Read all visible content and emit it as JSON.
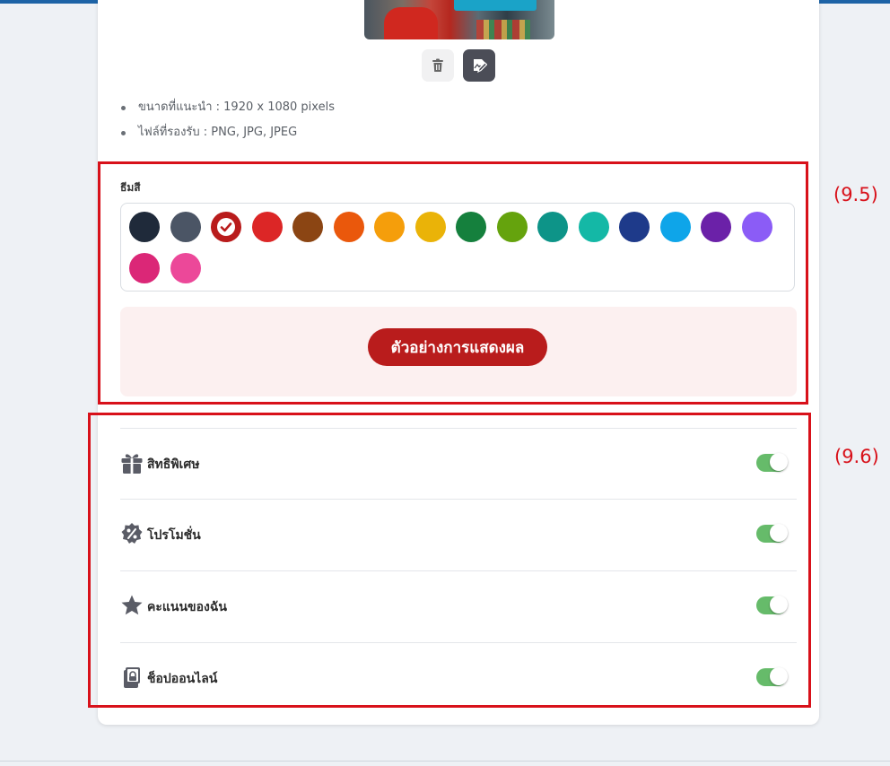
{
  "upload": {
    "hints": [
      "ขนาดที่แนะนำ : 1920 x 1080 pixels",
      "ไฟล์ที่รองรับ : PNG, JPG, JPEG"
    ]
  },
  "theme": {
    "label": "ธีมสี",
    "selected_index": 2,
    "swatches": [
      "#1f2a3a",
      "#4b5565",
      "#b91c1c",
      "#dc2626",
      "#8b4513",
      "#ea580c",
      "#f59e0b",
      "#eab308",
      "#15803d",
      "#65a30d",
      "#0d9488",
      "#14b8a6",
      "#1e3a8a",
      "#0ea5e9",
      "#6b21a8",
      "#8b5cf6",
      "#db2777",
      "#ec4899"
    ],
    "preview_label": "ตัวอย่างการแสดงผล"
  },
  "features": [
    {
      "label": "สิทธิพิเศษ",
      "icon": "gift-icon",
      "enabled": true
    },
    {
      "label": "โปรโมชั่น",
      "icon": "percent-badge-icon",
      "enabled": true
    },
    {
      "label": "คะแนนของฉัน",
      "icon": "star-icon",
      "enabled": true
    },
    {
      "label": "ช็อปออนไลน์",
      "icon": "shopping-bag-icon",
      "enabled": true
    }
  ],
  "annotations": {
    "theme": "(9.5)",
    "features": "(9.6)"
  },
  "colors": {
    "annotation": "#d8111a",
    "toggle_on": "#66bb6a",
    "accent": "#b91c1c"
  }
}
